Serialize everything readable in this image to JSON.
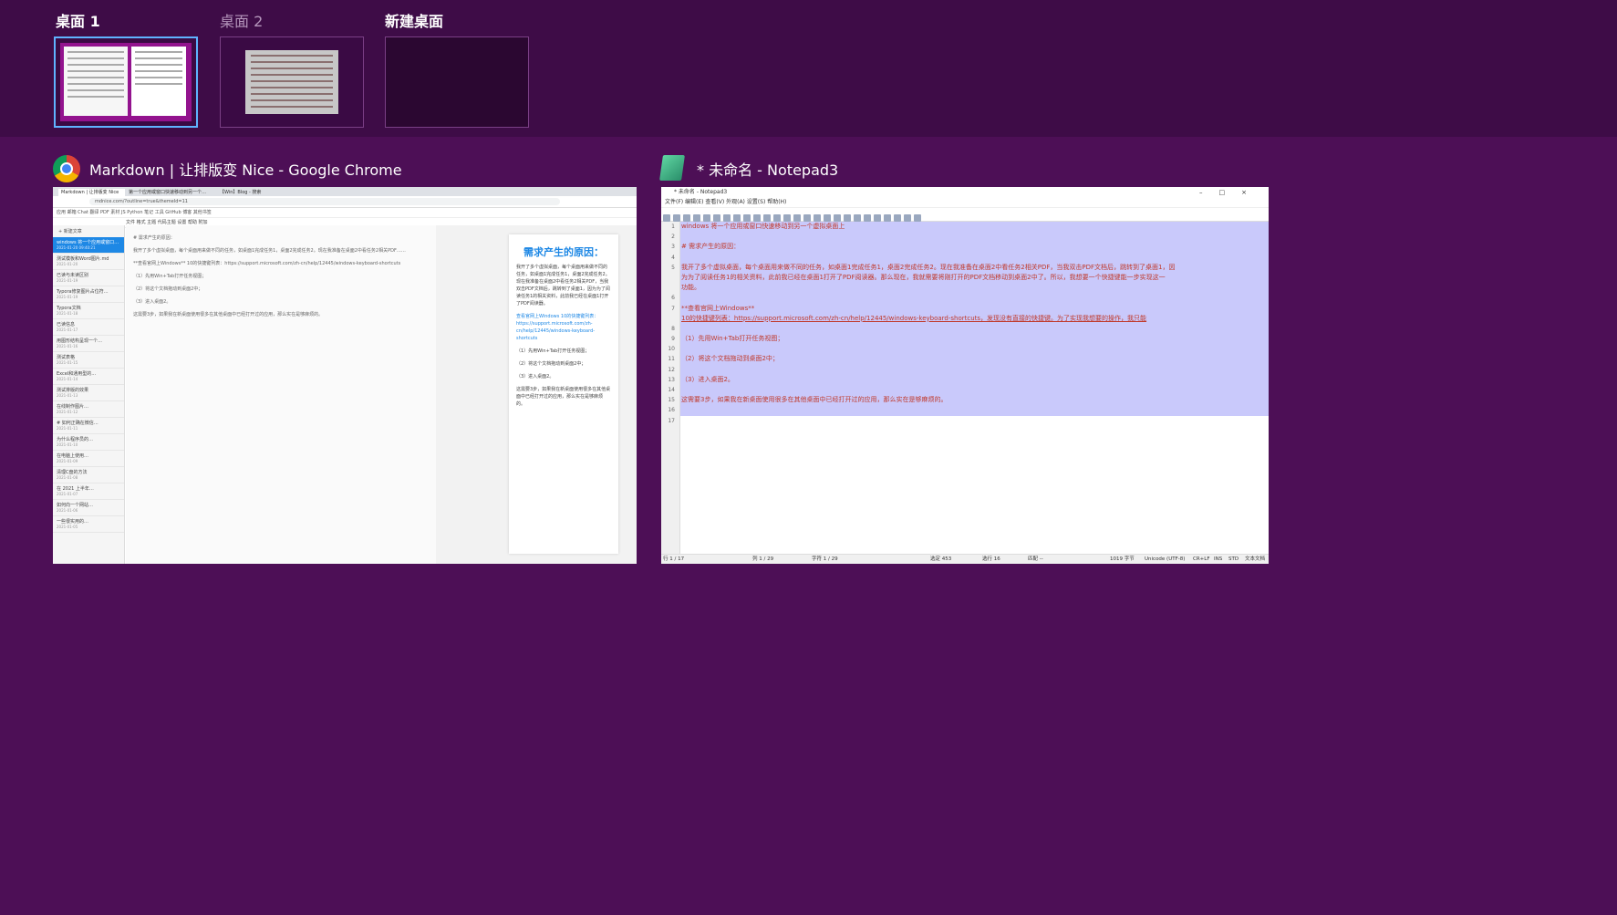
{
  "desktops": [
    {
      "label": "桌面 1"
    },
    {
      "label": "桌面 2"
    },
    {
      "label": "新建桌面"
    }
  ],
  "windows": {
    "chrome": {
      "title": "Markdown | 让排版变 Nice - Google Chrome",
      "tabs": [
        "Markdown | 让排版变 Nice",
        "第一个应用或窗口快速移动到另一个…",
        "【Win】Blog - 搜索"
      ],
      "url": "mdnice.com/?outline=true&themeId=11",
      "bookmarks": "应用  邮箱  Chat  翻译  PDF  素材  JS  Python  笔记  工具  GitHub  博客  其他书签",
      "menu": "文件  格式  主题  代码主题  设置  帮助  附加",
      "new_label": "+ 新建文章",
      "sidebar_items": [
        {
          "title": "windows 将一个应用或窗口…",
          "date": "2021-01-20 09:40:21"
        },
        {
          "title": "测试模板和Word图片.md",
          "date": "2021-01-20"
        },
        {
          "title": "已读与未读区别",
          "date": "2021-01-19"
        },
        {
          "title": "Typora修复图片占位符…",
          "date": "2021-01-19"
        },
        {
          "title": "Typora文档",
          "date": "2021-01-18"
        },
        {
          "title": "已读信息",
          "date": "2021-01-17"
        },
        {
          "title": "用图形结构呈现一个…",
          "date": "2021-01-16"
        },
        {
          "title": "测试表格",
          "date": "2021-01-15"
        },
        {
          "title": "Excel和通用型的…",
          "date": "2021-01-14"
        },
        {
          "title": "测试排版的效果",
          "date": "2021-01-13"
        },
        {
          "title": "在线制作图片…",
          "date": "2021-01-12"
        },
        {
          "title": "# 如何正确在微信…",
          "date": "2021-01-11"
        },
        {
          "title": "为什么程序员的…",
          "date": "2021-01-10"
        },
        {
          "title": "在电脑上使用…",
          "date": "2021-01-09"
        },
        {
          "title": "清理C盘的方法",
          "date": "2021-01-08"
        },
        {
          "title": "在 2021 上半年…",
          "date": "2021-01-07"
        },
        {
          "title": "如何向一个网站…",
          "date": "2021-01-06"
        },
        {
          "title": "一些很实用的…",
          "date": "2021-01-05"
        }
      ],
      "editor_heading": "# 需求产生的原因：",
      "editor_para": "我开了多个虚拟桌面，每个桌面用来做不同的任务，如桌面1完成任务1，桌面2完成任务2。现在我准备在桌面2中看任务2相关PDF……",
      "editor_link": "**查看官网上Windows** 10的快捷键列表：https://support.microsoft.com/zh-cn/help/12445/windows-keyboard-shortcuts",
      "editor_s1": "（1）先用Win+Tab打开任务视图；",
      "editor_s2": "（2）将这个文档拖动到桌面2中；",
      "editor_s3": "（3）进入桌面2。",
      "editor_end": "这需要3步，如果我在新桌面使用很多在其他桌面中已经打开过的应用，那么实在是够麻烦的。",
      "preview_heading": "需求产生的原因：",
      "preview_para": "我开了多个虚拟桌面，每个桌面用来做不同的任务，如桌面1完成任务1，桌面2完成任务2。现在我准备在桌面2中看任务2相关PDF，当我双击PDF文档后，跳转到了桌面1，因为为了阅读任务1的相关资料，此前我已经在桌面1打开了PDF阅读器。",
      "preview_link": "查看官网上Windows 10的快捷键列表：https://support.microsoft.com/zh-cn/help/12445/windows-keyboard-shortcuts",
      "preview_s1": "（1）先用Win+Tab打开任务视图；",
      "preview_s2": "（2）将这个文档拖动到桌面2中；",
      "preview_s3": "（3）进入桌面2。",
      "preview_end": "这需要3步，如果我在新桌面使用很多在其他桌面中已经打开过的应用，那么实在是够麻烦的。"
    },
    "notepad": {
      "title": "* 未命名 - Notepad3",
      "inner_title": "* 未命名 - Notepad3",
      "menu": "文件(F)  编辑(E)  查看(V)  外观(A)  设置(S)  帮助(H)",
      "lines": [
        "windows 将一个应用或窗口快速移动到另一个虚拟桌面上",
        "",
        "# 需求产生的原因：",
        "",
        "我开了多个虚拟桌面，每个桌面用来做不同的任务，如桌面1完成任务1，桌面2完成任务2。现在我准备在桌面2中看任务2相关PDF，当我双击PDF文档后，跳转到了桌面1，因",
        "为为了阅读任务1的相关资料，此前我已经在桌面1打开了PDF阅读器。那么现在，我就需要将刚打开的PDF文档移动到桌面2中了。所以，我想要一个快捷键能一步实现这一",
        "功能。",
        "",
        "**查看官网上Windows**",
        "10的快捷键列表：https://support.microsoft.com/zh-cn/help/12445/windows-keyboard-shortcuts，发现没有直接的快捷键。为了实现我想要的操作，我只能",
        "",
        "（1）先用Win+Tab打开任务视图；",
        "",
        "（2）将这个文档拖动到桌面2中；",
        "",
        "（3）进入桌面2。",
        "",
        "这需要3步，如果我在新桌面使用很多在其他桌面中已经打开过的应用，那么实在是够麻烦的。",
        ""
      ],
      "line_numbers": [
        "1",
        "2",
        "3",
        "4",
        "5",
        "",
        "",
        "6",
        "7",
        "",
        "8",
        "9",
        "10",
        "11",
        "12",
        "13",
        "14",
        "15",
        "16",
        "17"
      ],
      "status": {
        "line": "行 1 / 17",
        "col": "列 1 / 29",
        "char": "字符 1 / 29",
        "sel": "选定 453",
        "sel_lines": "选行 16",
        "match": "匹配 --",
        "bytes": "1019 字节",
        "encoding": "Unicode (UTF-8)",
        "eol": "CR+LF",
        "ins": "INS",
        "std": "STD",
        "type": "文本文档"
      }
    }
  },
  "colors": {
    "background": "#4d0f56",
    "top_bar": "#3e0c47",
    "selected_desktop_border": "#5fb3ff",
    "selection": "#c9c9fb",
    "notepad_text": "#c0392b",
    "accent": "#1e88e5"
  }
}
